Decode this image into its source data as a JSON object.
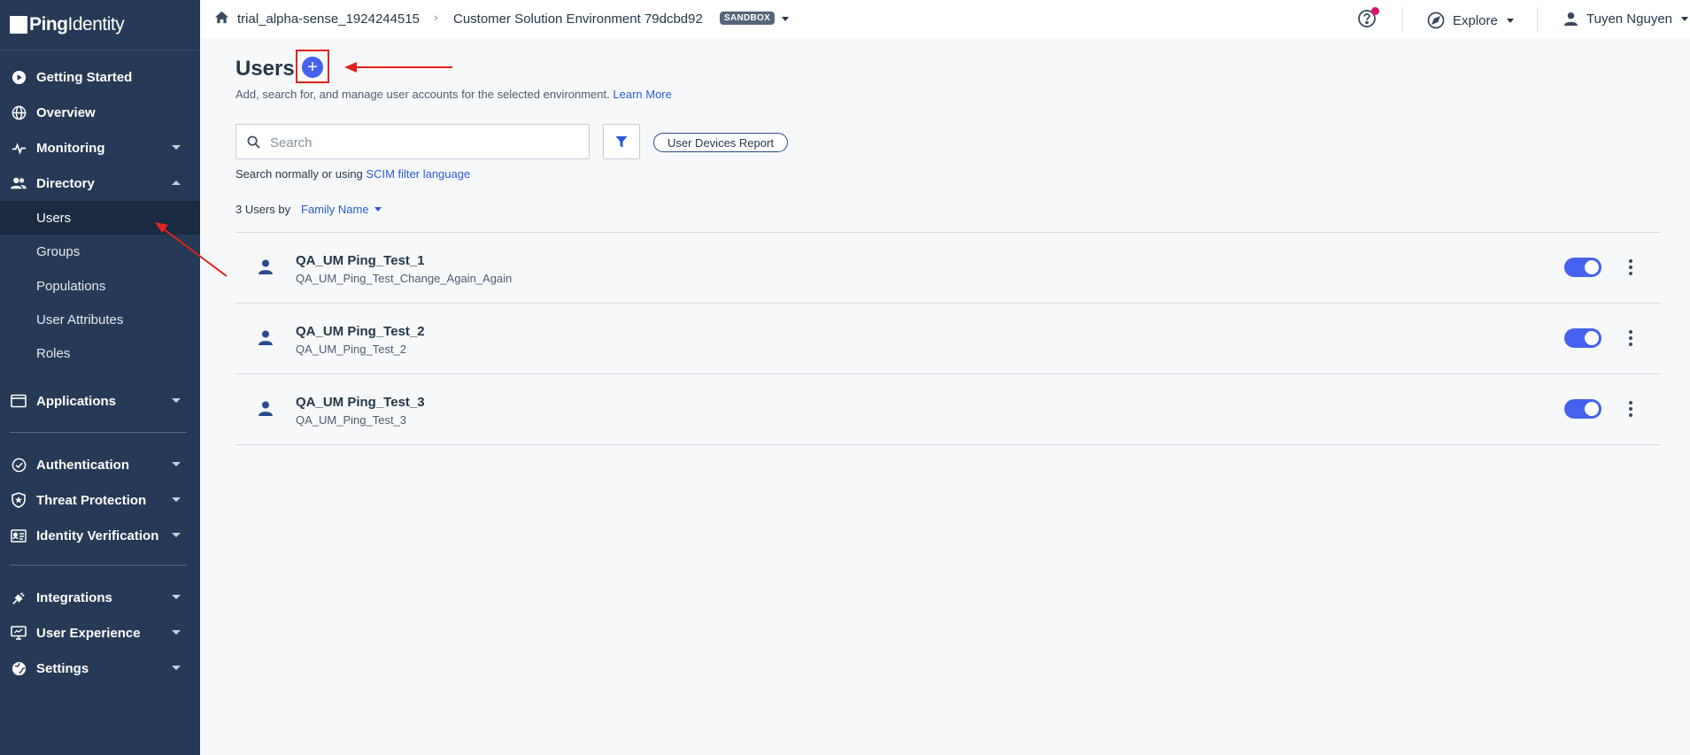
{
  "brand": {
    "bold": "Ping",
    "light": "Identity"
  },
  "sidebar": {
    "items": [
      {
        "label": "Getting Started"
      },
      {
        "label": "Overview"
      },
      {
        "label": "Monitoring"
      },
      {
        "label": "Directory"
      },
      {
        "label": "Applications"
      },
      {
        "label": "Authentication"
      },
      {
        "label": "Threat Protection"
      },
      {
        "label": "Identity Verification"
      },
      {
        "label": "Integrations"
      },
      {
        "label": "User Experience"
      },
      {
        "label": "Settings"
      }
    ],
    "directory_sub": [
      {
        "label": "Users",
        "active": true
      },
      {
        "label": "Groups"
      },
      {
        "label": "Populations"
      },
      {
        "label": "User Attributes"
      },
      {
        "label": "Roles"
      }
    ]
  },
  "topbar": {
    "org": "trial_alpha-sense_1924244515",
    "environment": "Customer Solution Environment 79dcbd92",
    "badge": "SANDBOX",
    "explore": "Explore",
    "user": "Tuyen Nguyen"
  },
  "page": {
    "title": "Users",
    "add_label": "+",
    "subtitle": "Add, search for, and manage user accounts for the selected environment.",
    "learn_more": "Learn More",
    "search_placeholder": "Search",
    "report_button": "User Devices Report",
    "hint_prefix": "Search normally or using",
    "hint_link": "SCIM filter language",
    "sort_prefix": "3 Users by",
    "sort_field": "Family Name"
  },
  "users": [
    {
      "name": "QA_UM Ping_Test_1",
      "username": "QA_UM_Ping_Test_Change_Again_Again",
      "enabled": true
    },
    {
      "name": "QA_UM Ping_Test_2",
      "username": "QA_UM_Ping_Test_2",
      "enabled": true
    },
    {
      "name": "QA_UM Ping_Test_3",
      "username": "QA_UM_Ping_Test_3",
      "enabled": true
    }
  ],
  "colors": {
    "sidebar": "#263956",
    "accent": "#4462ed",
    "link": "#2a5bd7",
    "annotation": "#e0241b"
  }
}
